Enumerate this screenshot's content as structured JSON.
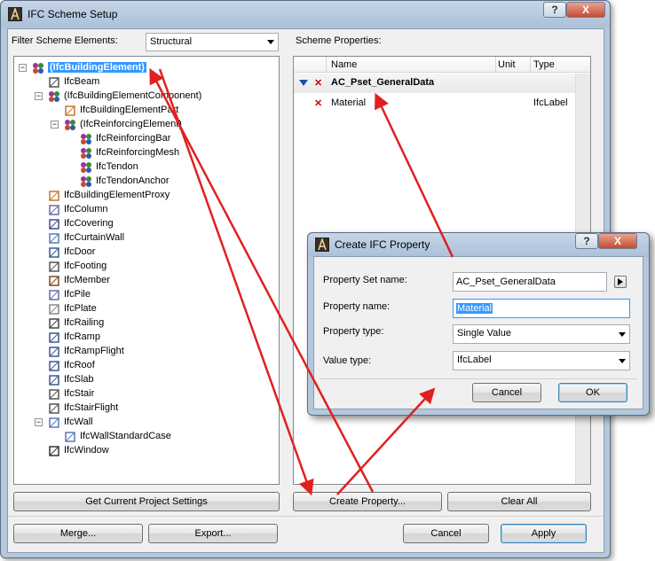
{
  "window": {
    "title": "IFC Scheme Setup",
    "help_glyph": "?",
    "close_glyph": "X"
  },
  "left": {
    "filter_label": "Filter Scheme Elements:",
    "filter_value": "Structural",
    "tree": [
      {
        "label": "(IfcBuildingElement)",
        "icon": "group-icon",
        "selected": true,
        "expander": "−"
      },
      {
        "label": "IfcBeam",
        "icon": "beam-icon"
      },
      {
        "label": "(IfcBuildingElementComponent)",
        "icon": "group-icon",
        "expander": "−"
      },
      {
        "label": "IfcBuildingElementPart",
        "icon": "part-icon"
      },
      {
        "label": "(IfcReinforcingElement)",
        "icon": "group-icon",
        "expander": "−"
      },
      {
        "label": "IfcReinforcingBar",
        "icon": "group-icon"
      },
      {
        "label": "IfcReinforcingMesh",
        "icon": "group-icon"
      },
      {
        "label": "IfcTendon",
        "icon": "group-icon"
      },
      {
        "label": "IfcTendonAnchor",
        "icon": "group-icon"
      },
      {
        "label": "IfcBuildingElementProxy",
        "icon": "proxy-icon"
      },
      {
        "label": "IfcColumn",
        "icon": "column-icon"
      },
      {
        "label": "IfcCovering",
        "icon": "covering-icon"
      },
      {
        "label": "IfcCurtainWall",
        "icon": "curtain-wall-icon"
      },
      {
        "label": "IfcDoor",
        "icon": "door-icon"
      },
      {
        "label": "IfcFooting",
        "icon": "footing-icon"
      },
      {
        "label": "IfcMember",
        "icon": "member-icon"
      },
      {
        "label": "IfcPile",
        "icon": "pile-icon"
      },
      {
        "label": "IfcPlate",
        "icon": "plate-icon"
      },
      {
        "label": "IfcRailing",
        "icon": "railing-icon"
      },
      {
        "label": "IfcRamp",
        "icon": "ramp-icon"
      },
      {
        "label": "IfcRampFlight",
        "icon": "ramp-flight-icon"
      },
      {
        "label": "IfcRoof",
        "icon": "roof-icon"
      },
      {
        "label": "IfcSlab",
        "icon": "slab-icon"
      },
      {
        "label": "IfcStair",
        "icon": "stair-icon"
      },
      {
        "label": "IfcStairFlight",
        "icon": "stair-flight-icon"
      },
      {
        "label": "IfcWall",
        "icon": "wall-icon",
        "expander": "−"
      },
      {
        "label": "IfcWallStandardCase",
        "icon": "wall-icon"
      },
      {
        "label": "IfcWindow",
        "icon": "window-icon"
      }
    ],
    "get_settings_button": "Get Current Project Settings"
  },
  "right": {
    "props_label": "Scheme Properties:",
    "columns": [
      "Name",
      "Unit",
      "Type"
    ],
    "group": {
      "name": "AC_Pset_GeneralData"
    },
    "rows": [
      {
        "name": "Material",
        "unit": "",
        "type": "IfcLabel"
      }
    ],
    "create_button": "Create Property...",
    "clear_button": "Clear All"
  },
  "footer": {
    "merge": "Merge...",
    "export": "Export...",
    "cancel": "Cancel",
    "apply": "Apply"
  },
  "dialog": {
    "title": "Create IFC Property",
    "help_glyph": "?",
    "close_glyph": "X",
    "pset_label": "Property Set name:",
    "pset_value": "AC_Pset_GeneralData",
    "name_label": "Property name:",
    "name_value": "Material",
    "type_label": "Property type:",
    "type_value": "Single Value",
    "value_type_label": "Value type:",
    "value_type_value": "IfcLabel",
    "cancel": "Cancel",
    "ok": "OK"
  },
  "colors": {
    "selection": "#3399ff",
    "annotation_arrow": "#e02020",
    "delete_mark": "#d40000"
  }
}
